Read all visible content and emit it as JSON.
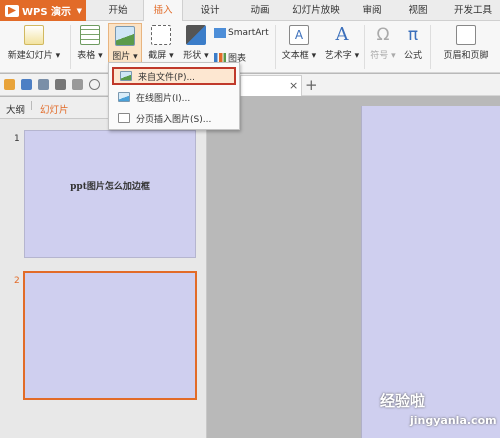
{
  "app": {
    "name": "WPS 演示"
  },
  "tabs": [
    "开始",
    "插入",
    "设计",
    "动画",
    "幻灯片放映",
    "审阅",
    "视图",
    "开发工具"
  ],
  "ribbon": {
    "new_slide": "新建幻灯片",
    "table": "表格",
    "picture": "图片",
    "screenshot": "截屏",
    "shape": "形状",
    "smartart": "SmartArt",
    "chart": "图表",
    "textbox": "文本框",
    "wordart": "艺术字",
    "symbol": "符号",
    "formula": "公式",
    "header_footer": "页眉和页脚"
  },
  "picture_menu": {
    "items": [
      "来自文件(P)...",
      "在线图片(I)...",
      "分页插入图片(S)..."
    ]
  },
  "left_pane": {
    "tab_outline": "大纲",
    "tab_slides": "幻灯片",
    "slides": [
      {
        "number": "1",
        "text": "ppt图片怎么加边框"
      },
      {
        "number": "2",
        "text": ""
      }
    ]
  },
  "watermark": {
    "main": "经验啦",
    "sub": "jingyanla.com"
  },
  "colors": {
    "accent": "#e26b28",
    "slide_bg": "#cfcfef",
    "menu_highlight_border": "#c0392b"
  }
}
